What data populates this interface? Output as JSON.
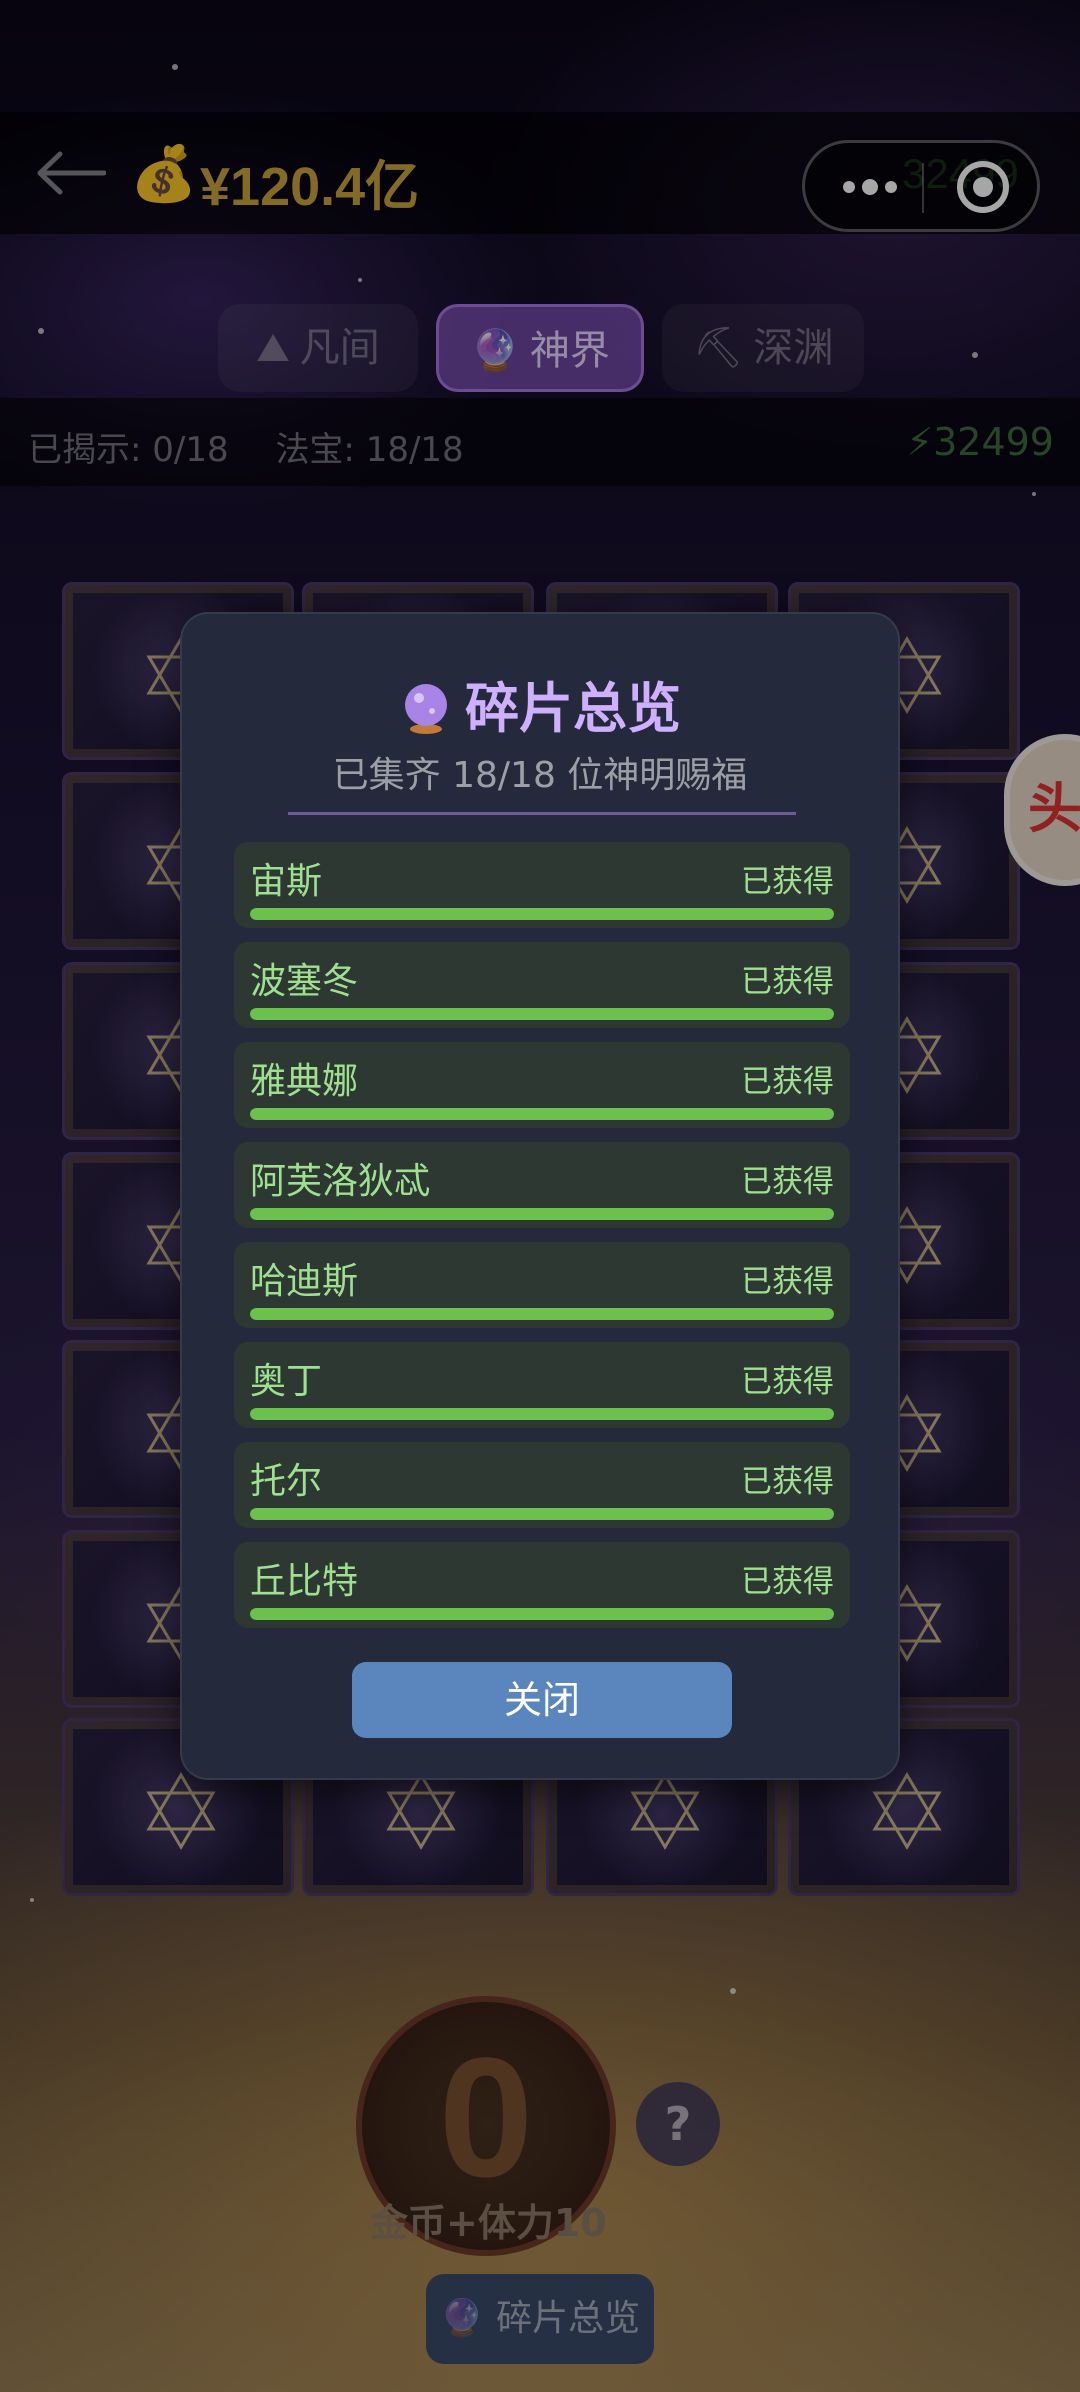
{
  "header": {
    "money_icon": "money-bag-icon",
    "money": "¥120.4亿",
    "capsule_energy": "32499"
  },
  "tabs": [
    {
      "label": "凡间",
      "icon": "mountain-icon",
      "active": false
    },
    {
      "label": "神界",
      "icon": "crystal-ball-icon",
      "active": true
    },
    {
      "label": "深渊",
      "icon": "pickaxe-icon",
      "active": false
    }
  ],
  "status": {
    "revealed": "已揭示: 0/18",
    "treasure": "法宝: 18/18",
    "energy": "⚡32499"
  },
  "side_bubble": {
    "text": "头"
  },
  "bottom": {
    "coin_value": "0",
    "coin_caption": "金币+体力10",
    "help": "?",
    "fragment_button": "碎片总览"
  },
  "modal": {
    "title": "碎片总览",
    "subtitle": "已集齐 18/18 位神明赐福",
    "items": [
      {
        "name": "宙斯",
        "status": "已获得",
        "progress": 1.0
      },
      {
        "name": "波塞冬",
        "status": "已获得",
        "progress": 1.0
      },
      {
        "name": "雅典娜",
        "status": "已获得",
        "progress": 1.0
      },
      {
        "name": "阿芙洛狄忒",
        "status": "已获得",
        "progress": 1.0
      },
      {
        "name": "哈迪斯",
        "status": "已获得",
        "progress": 1.0
      },
      {
        "name": "奥丁",
        "status": "已获得",
        "progress": 1.0
      },
      {
        "name": "托尔",
        "status": "已获得",
        "progress": 1.0
      },
      {
        "name": "丘比特",
        "status": "已获得",
        "progress": 1.0
      }
    ],
    "close_label": "关闭"
  },
  "colors": {
    "accent_purple": "#cfb0ff",
    "progress_green": "#6cc04c",
    "close_button": "#5a86bd",
    "gold_text": "#c9a53a"
  }
}
